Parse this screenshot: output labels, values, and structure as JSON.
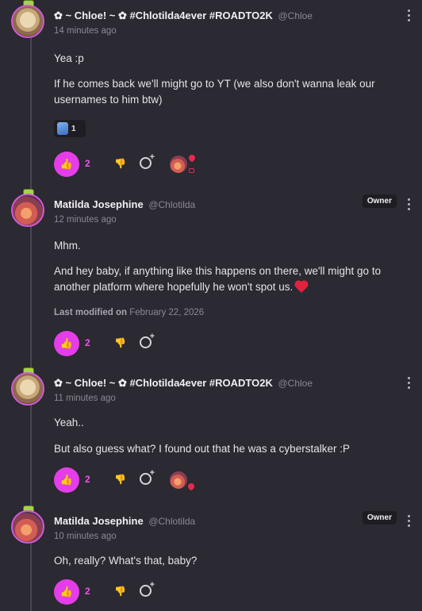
{
  "posts": [
    {
      "display_name": "✿ ~ Chloe! ~ ✿ #Chlotilda4ever #ROADTO2K",
      "handle": "@Chloe",
      "time": "14 minutes ago",
      "paragraphs": [
        "Yea :p",
        "If he comes back we'll might go to YT (we also don't wanna leak our usernames to him btw)"
      ],
      "reaction_chip_count": "1",
      "likes": "2"
    },
    {
      "display_name": "Matilda Josephine",
      "handle": "@Chlotilda",
      "badge": "Owner",
      "time": "12 minutes ago",
      "paragraphs": [
        "Mhm.",
        "And hey baby, if anything like this happens on there, we'll might go to another platform where hopefully he won't spot us."
      ],
      "modified_label": "Last modified on",
      "modified_date": "February 22, 2026",
      "likes": "2"
    },
    {
      "display_name": "✿ ~ Chloe! ~ ✿ #Chlotilda4ever #ROADTO2K",
      "handle": "@Chloe",
      "time": "11 minutes ago",
      "paragraphs": [
        "Yeah..",
        "But also guess what? I found out that he was a cyberstalker :P"
      ],
      "likes": "2"
    },
    {
      "display_name": "Matilda Josephine",
      "handle": "@Chlotilda",
      "badge": "Owner",
      "time": "10 minutes ago",
      "paragraphs": [
        "Oh, really? What's that, baby?"
      ],
      "likes": "2"
    }
  ],
  "icons": {
    "like": "thumbs-up-icon",
    "dislike": "thumbs-down-icon",
    "add_reaction": "add-reaction-icon",
    "menu": "more-vertical-icon",
    "heart": "heart-icon"
  },
  "colors": {
    "background": "#2b2931",
    "accent": "#e43de9",
    "like_count": "#ea55ee",
    "heart": "#e0213f"
  }
}
